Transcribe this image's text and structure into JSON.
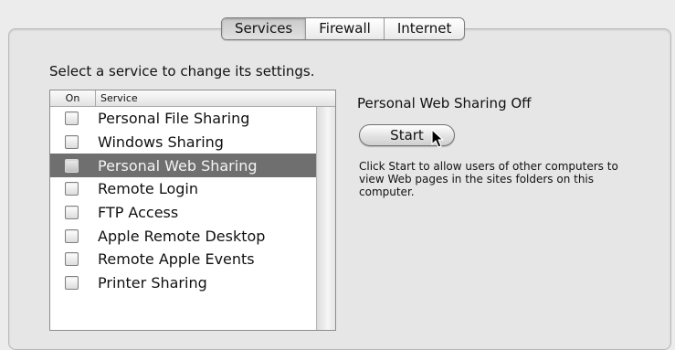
{
  "tabs": [
    {
      "label": "Services",
      "selected": true
    },
    {
      "label": "Firewall",
      "selected": false
    },
    {
      "label": "Internet",
      "selected": false
    }
  ],
  "instruction": "Select a service to change its settings.",
  "list": {
    "header_on": "On",
    "header_service": "Service",
    "rows": [
      {
        "label": "Personal File Sharing",
        "checked": false,
        "selected": false
      },
      {
        "label": "Windows Sharing",
        "checked": false,
        "selected": false
      },
      {
        "label": "Personal Web Sharing",
        "checked": false,
        "selected": true
      },
      {
        "label": "Remote Login",
        "checked": false,
        "selected": false
      },
      {
        "label": "FTP Access",
        "checked": false,
        "selected": false
      },
      {
        "label": "Apple Remote Desktop",
        "checked": false,
        "selected": false
      },
      {
        "label": "Remote Apple Events",
        "checked": false,
        "selected": false
      },
      {
        "label": "Printer Sharing",
        "checked": false,
        "selected": false
      }
    ]
  },
  "detail": {
    "status": "Personal Web Sharing Off",
    "start_label": "Start",
    "description": "Click Start to allow users of other computers to view Web pages in the sites folders on this computer."
  },
  "icons": {
    "cursor": "arrow-cursor-icon"
  },
  "colors": {
    "selected_row": "#6f6f6f",
    "window_bg": "#ececec"
  }
}
